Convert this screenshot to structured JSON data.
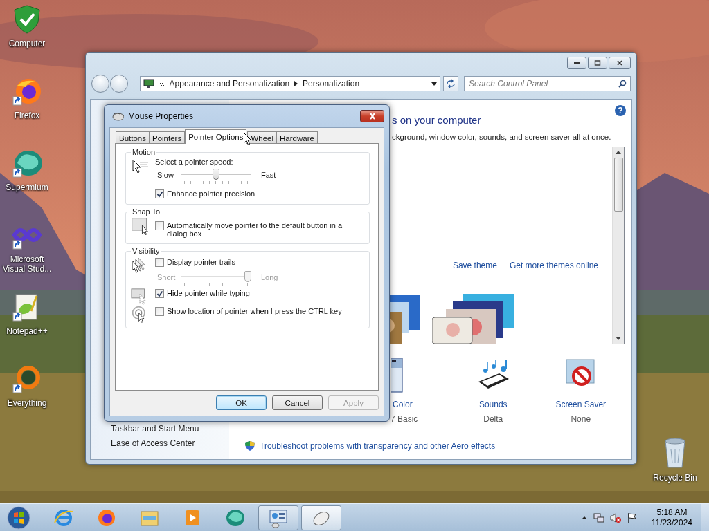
{
  "desktop_icons": [
    {
      "label": "Computer",
      "kind": "shield",
      "shortcut": false
    },
    {
      "label": "Firefox",
      "kind": "firefox",
      "shortcut": true
    },
    {
      "label": "Supermium",
      "kind": "supermium",
      "shortcut": true
    },
    {
      "label": "Microsoft Visual Stud...",
      "kind": "infinity",
      "shortcut": true
    },
    {
      "label": "Notepad++",
      "kind": "notepad",
      "shortcut": true
    },
    {
      "label": "Everything",
      "kind": "ring",
      "shortcut": true
    }
  ],
  "recycle_bin": {
    "label": "Recycle Bin"
  },
  "control_panel": {
    "breadcrumb": [
      "Appearance and Personalization",
      "Personalization"
    ],
    "search_placeholder": "Search Control Panel",
    "help": "?",
    "heading": "s on your computer",
    "description": "ckground, window color, sounds, and screen saver all at once.",
    "theme_links": [
      "Save theme",
      "Get more themes online"
    ],
    "settings": [
      {
        "label": "Color",
        "value": "7 Basic",
        "kind": "color"
      },
      {
        "label": "Sounds",
        "value": "Delta",
        "kind": "sounds"
      },
      {
        "label": "Screen Saver",
        "value": "None",
        "kind": "screensaver"
      }
    ],
    "sidebar_links": [
      "Taskbar and Start Menu",
      "Ease of Access Center"
    ],
    "troubleshoot_link": "Troubleshoot problems with transparency and other Aero effects"
  },
  "mouse_dialog": {
    "title": "Mouse Properties",
    "tabs": [
      {
        "label": "Buttons",
        "selected": false
      },
      {
        "label": "Pointers",
        "selected": false
      },
      {
        "label": "Pointer Options",
        "selected": true
      },
      {
        "label": "Wheel",
        "selected": false
      },
      {
        "label": "Hardware",
        "selected": false
      }
    ],
    "motion": {
      "title": "Motion",
      "prompt": "Select a pointer speed:",
      "slider": {
        "min_label": "Slow",
        "max_label": "Fast",
        "level": 0.5,
        "disabled": false
      },
      "enhance": {
        "label": "Enhance pointer precision",
        "checked": true
      }
    },
    "snap_to": {
      "title": "Snap To",
      "option": {
        "label": "Automatically move pointer to the default button in a dialog box",
        "checked": false
      }
    },
    "visibility": {
      "title": "Visibility",
      "trails": {
        "label": "Display pointer trails",
        "checked": false
      },
      "trail_slider": {
        "min_label": "Short",
        "max_label": "Long",
        "level": 1,
        "disabled": true
      },
      "hide": {
        "label": "Hide pointer while typing",
        "checked": true
      },
      "ctrl": {
        "label": "Show location of pointer when I press the CTRL key",
        "checked": false
      }
    },
    "buttons": [
      {
        "label": "OK",
        "kind": "default",
        "disabled": false
      },
      {
        "label": "Cancel",
        "kind": "normal",
        "disabled": false
      },
      {
        "label": "Apply",
        "kind": "normal",
        "disabled": true
      }
    ]
  },
  "taskbar": {
    "items": [
      {
        "kind": "ie",
        "open": false,
        "selected": false
      },
      {
        "kind": "firefox",
        "open": false,
        "selected": false
      },
      {
        "kind": "folder",
        "open": false,
        "selected": false
      },
      {
        "kind": "media",
        "open": false,
        "selected": false
      },
      {
        "kind": "supermium",
        "open": false,
        "selected": false
      },
      {
        "kind": "controlpanel",
        "open": true,
        "selected": false
      },
      {
        "kind": "mouse",
        "open": true,
        "selected": true
      }
    ],
    "clock": {
      "time": "5:18 AM",
      "date": "11/23/2024"
    }
  }
}
